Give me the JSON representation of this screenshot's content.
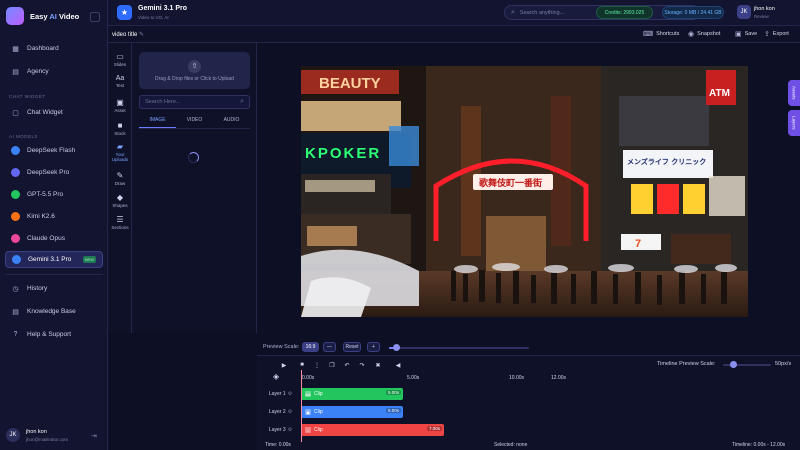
{
  "app": {
    "brand_prefix": "Easy",
    "brand_ai": "AI",
    "brand_suffix": "Video"
  },
  "sidebar": {
    "main": [
      {
        "label": "Dashboard",
        "icon": "grid-icon"
      },
      {
        "label": "Agency",
        "icon": "building-icon"
      }
    ],
    "chat_section": "CHAT WIDGET",
    "chat_items": [
      {
        "label": "Chat Widget",
        "icon": "chat-icon"
      }
    ],
    "ai_section": "AI MODELS",
    "models": [
      {
        "label": "DeepSeek Flash",
        "color": "#3b82f6"
      },
      {
        "label": "DeepSeek Pro",
        "color": "#6366f1"
      },
      {
        "label": "GPT-5.5 Pro",
        "color": "#22c55e"
      },
      {
        "label": "Kimi K2.6",
        "color": "#f97316"
      },
      {
        "label": "Claude Opus",
        "color": "#ec4899"
      },
      {
        "label": "Gemini 3.1 Pro",
        "color": "#3b82f6",
        "active": true,
        "badge": "NEW"
      }
    ],
    "bottom": [
      {
        "label": "History",
        "icon": "clock-icon"
      },
      {
        "label": "Knowledge Base",
        "icon": "book-icon"
      },
      {
        "label": "Help & Support",
        "icon": "help-icon"
      }
    ],
    "user": {
      "name": "jhon kon",
      "email": "jhon@mailinator.com",
      "initials": "JK"
    }
  },
  "topbar": {
    "project_title": "Gemini 3.1 Pro",
    "project_sub": "Video to VO, AI",
    "search_placeholder": "Search anything...",
    "credits": "Credits: 2993.025",
    "storage": "Storage: 0 MB / 24.41 GB",
    "user_name": "jhon kon",
    "user_role": "Review"
  },
  "subbar": {
    "video_title": "video title",
    "shortcuts": "Shortcuts",
    "snapshot": "Snapshot",
    "save": "Save",
    "export": "Export"
  },
  "tools": [
    {
      "label": "Slides",
      "icon": "slides-icon",
      "glyph": "▭"
    },
    {
      "label": "Text",
      "icon": "text-icon",
      "glyph": "Aa"
    },
    {
      "label": "Asset",
      "icon": "image-icon",
      "glyph": "▣"
    },
    {
      "label": "Stock",
      "icon": "stock-icon",
      "glyph": "■"
    },
    {
      "label": "Your Uploads",
      "icon": "folder-icon",
      "glyph": "▰",
      "active": true
    },
    {
      "label": "Draw",
      "icon": "pen-icon",
      "glyph": "✎"
    },
    {
      "label": "Shapes",
      "icon": "shapes-icon",
      "glyph": "◆"
    },
    {
      "label": "Sections",
      "icon": "sections-icon",
      "glyph": "☰"
    }
  ],
  "panel": {
    "dropzone_text": "Drag & Drop files or Click to Upload",
    "search_placeholder": "Search Here...",
    "tabs": [
      "IMAGE",
      "VIDEO",
      "AUDIO"
    ],
    "active_tab": "IMAGE"
  },
  "stage": {
    "side_tabs": [
      "Assets",
      "Layers"
    ]
  },
  "scale": {
    "label": "Preview Scale:",
    "buttons": [
      "16:9",
      "—",
      "Reset",
      "+"
    ],
    "slider_value_pct": 5
  },
  "timeline": {
    "scale_label": "Timeline Preview Scale:",
    "scale_value": "50px/s",
    "scale_slider_pct": 20,
    "ruler": [
      "0.00s",
      "5.00s",
      "10.00s",
      "12.00s"
    ],
    "layers": [
      {
        "label": "Layer 1",
        "clip": "Clip",
        "duration": "5.00s",
        "color": "#22c55e",
        "icon": "Aa"
      },
      {
        "label": "Layer 2",
        "clip": "Clip",
        "duration": "5.00s",
        "color": "#3b82f6",
        "icon": "▣"
      },
      {
        "label": "Layer 3",
        "clip": "Clip",
        "duration": "7.00s",
        "color": "#ef4444",
        "icon": "♪"
      }
    ],
    "footer_time": "Time: 0.00s",
    "footer_selected": "Selected: none",
    "footer_range": "Timeline: 0.00s - 12.00s"
  },
  "preview_signs": {
    "beauty": "BEAUTY",
    "kpoker": "KPOKER",
    "kabukicho": "歌舞伎町一番街",
    "atm": "ATM",
    "clinic": "メンズライフ クリニック",
    "seven": "7"
  }
}
